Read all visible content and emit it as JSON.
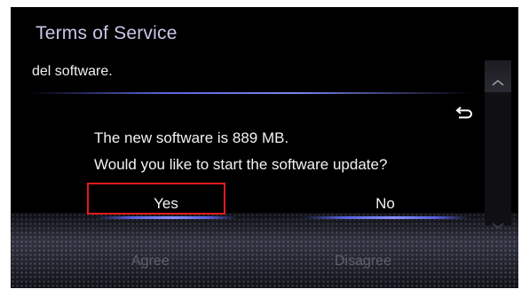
{
  "screen": {
    "title": "Terms of Service",
    "body_text": "del software.",
    "icons": {
      "scroll_up": "chevron-up-icon",
      "scroll_down": "chevron-down-icon",
      "back": "back-arrow-icon"
    }
  },
  "dialog": {
    "message_line1": "The new software is 889 MB.",
    "message_line2": "Would you like to start the software update?",
    "yes_label": "Yes",
    "no_label": "No",
    "highlight_color": "#e11b1b"
  },
  "footer": {
    "agree_label": "Agree",
    "disagree_label": "Disagree"
  }
}
